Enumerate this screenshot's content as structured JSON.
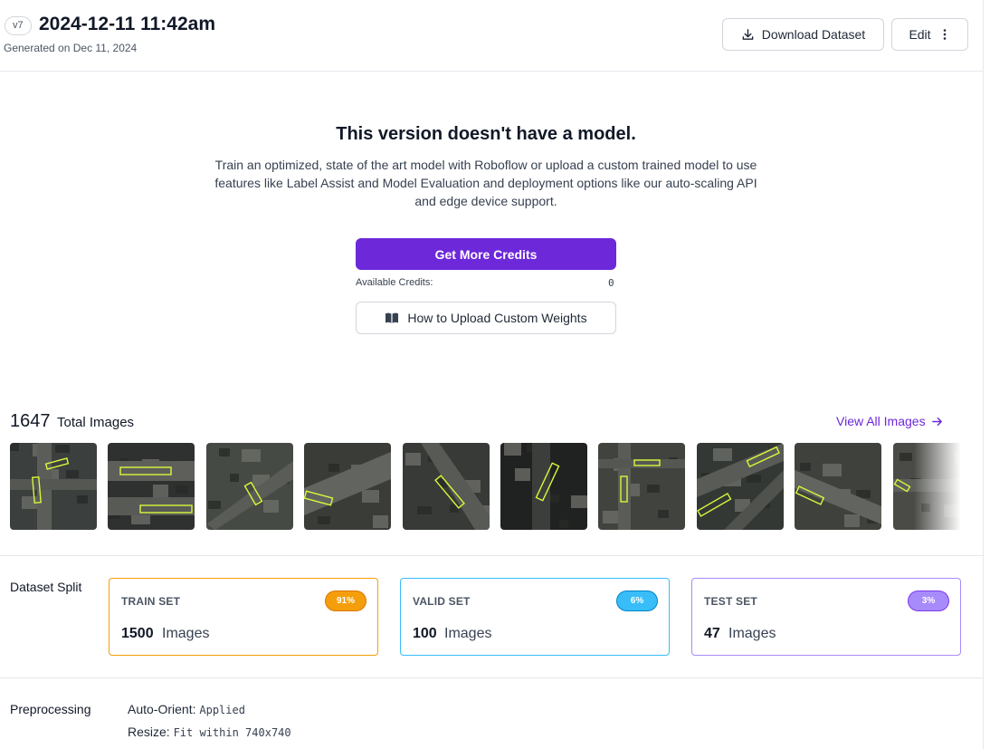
{
  "header": {
    "version": "v7",
    "title": "2024-12-11 11:42am",
    "generated": "Generated on Dec 11, 2024",
    "download_label": "Download Dataset",
    "edit_label": "Edit"
  },
  "model_empty": {
    "title": "This version doesn't have a model.",
    "description": "Train an optimized, state of the art model with Roboflow or upload a custom trained model to use features like Label Assist and Model Evaluation and deployment options like our auto-scaling API and edge device support.",
    "credits_button": "Get More Credits",
    "available_credits_label": "Available Credits:",
    "available_credits_value": "0",
    "upload_button": "How to Upload Custom Weights"
  },
  "images": {
    "total_count": "1647",
    "total_label": "Total Images",
    "view_all": "View All Images",
    "thumbnail_count": 10
  },
  "dataset_split": {
    "label": "Dataset Split",
    "unit": "Images",
    "cards": [
      {
        "name": "TRAIN SET",
        "percent": "91%",
        "count": "1500",
        "border": "#f59e0b",
        "badge_bg": "#f59e0b",
        "badge_border": "#d97706"
      },
      {
        "name": "VALID SET",
        "percent": "6%",
        "count": "100",
        "border": "#38bdf8",
        "badge_bg": "#38bdf8",
        "badge_border": "#0284c7"
      },
      {
        "name": "TEST SET",
        "percent": "3%",
        "count": "47",
        "border": "#a78bfa",
        "badge_bg": "#a78bfa",
        "badge_border": "#7c3aed"
      }
    ]
  },
  "preprocessing": {
    "label": "Preprocessing",
    "items": [
      {
        "key": "Auto-Orient:",
        "value": "Applied"
      },
      {
        "key": "Resize:",
        "value": "Fit within 740x740"
      }
    ]
  },
  "colors": {
    "accent": "#6d28d9",
    "annotation_box": "#d9f73b"
  }
}
